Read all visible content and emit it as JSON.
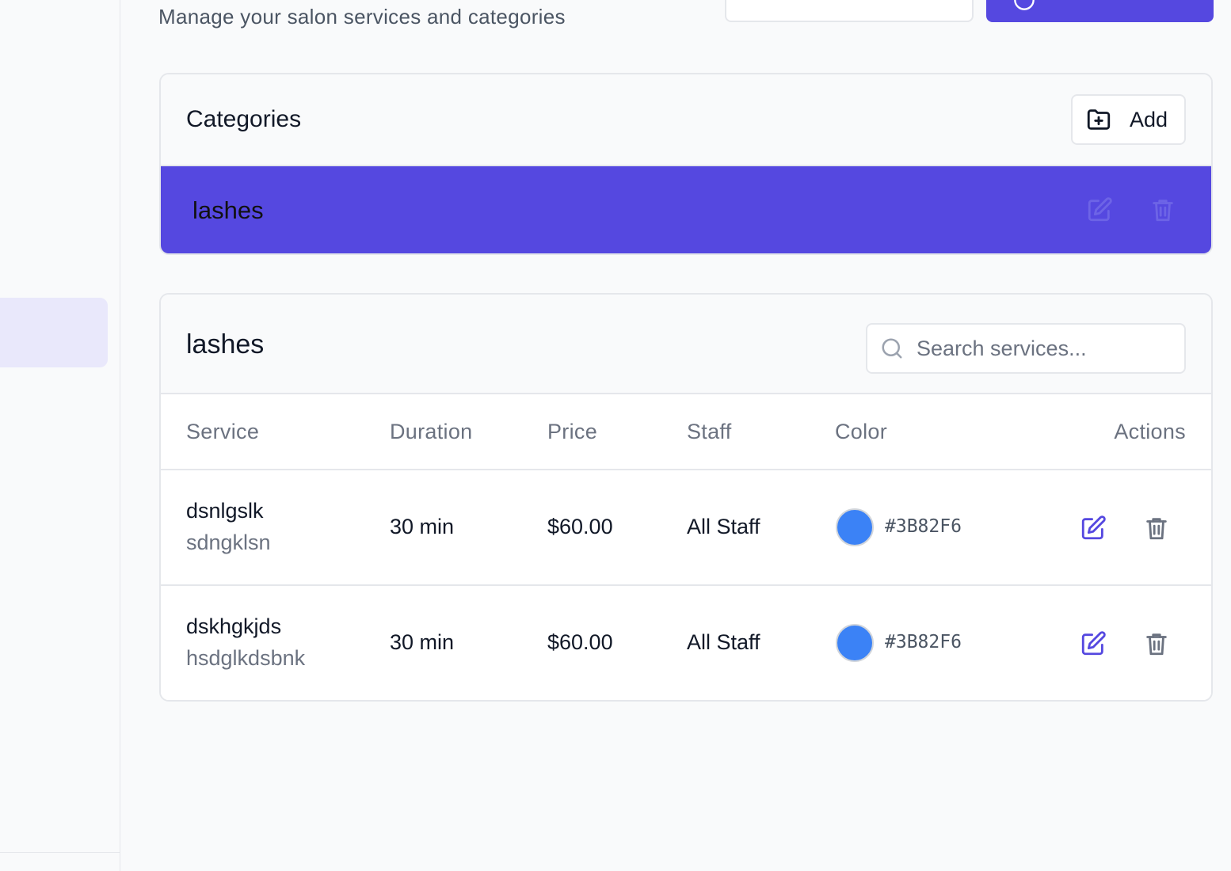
{
  "header": {
    "subtitle": "Manage your salon services and categories"
  },
  "categories": {
    "title": "Categories",
    "add_label": "Add",
    "items": [
      {
        "name": "lashes",
        "selected": true
      }
    ]
  },
  "services": {
    "title": "lashes",
    "search_placeholder": "Search services...",
    "columns": [
      "Service",
      "Duration",
      "Price",
      "Staff",
      "Color",
      "Actions"
    ],
    "rows": [
      {
        "name": "dsnlgslk",
        "description": "sdngklsn",
        "duration": "30 min",
        "price": "$60.00",
        "staff": "All Staff",
        "color": "#3B82F6"
      },
      {
        "name": "dskhgkjds",
        "description": "hsdglkdsbnk",
        "duration": "30 min",
        "price": "$60.00",
        "staff": "All Staff",
        "color": "#3B82F6"
      }
    ]
  },
  "colors": {
    "accent": "#5548E0",
    "edit_icon": "#5548E0",
    "delete_icon": "#6B7280"
  },
  "icons": {
    "add": "folder-plus-icon",
    "search": "search-icon",
    "edit": "edit-icon",
    "delete": "trash-icon"
  }
}
